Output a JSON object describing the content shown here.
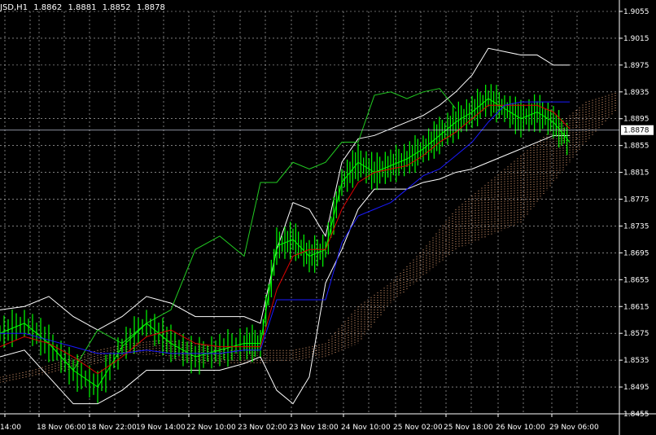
{
  "header": {
    "symbol": "JSD,H1",
    "open": "1.8862",
    "high": "1.8881",
    "low": "1.8852",
    "close": "1.8878"
  },
  "colors": {
    "background": "#000000",
    "grid": "#c8c8c8",
    "axis": "#ffffff",
    "candles": "#00ff00",
    "bollinger": "#ffffff",
    "chikou": "#22cc22",
    "tenkan": "#dd0000",
    "kijun": "#1a1aff",
    "kumo": "#f0a878",
    "current_price_line": "#b8c0d0"
  },
  "chart_data": {
    "type": "line",
    "y_ticks": [
      "1.9055",
      "1.9015",
      "1.8975",
      "1.8935",
      "1.8895",
      "1.8855",
      "1.8815",
      "1.8775",
      "1.8735",
      "1.8695",
      "1.8655",
      "1.8615",
      "1.8575",
      "1.8535",
      "1.8495",
      "1.8455"
    ],
    "ylim": [
      1.8455,
      1.9055
    ],
    "current_price": "1.8878",
    "x_labels": [
      "14:00",
      "18 Nov 06:00",
      "18 Nov 22:00",
      "19 Nov 14:00",
      "22 Nov 10:00",
      "23 Nov 02:00",
      "23 Nov 18:00",
      "24 Nov 10:00",
      "25 Nov 02:00",
      "25 Nov 18:00",
      "26 Nov 10:00",
      "29 Nov 06:00"
    ],
    "grid": true,
    "series": [
      {
        "key": "close",
        "x": [
          0,
          30,
          60,
          90,
          120,
          150,
          180,
          210,
          240,
          270,
          300,
          320,
          340,
          360,
          380,
          400,
          420,
          440,
          460,
          480,
          500,
          520,
          540,
          560,
          580,
          600,
          620,
          640,
          660,
          680,
          700
        ],
        "values": [
          1.8575,
          1.859,
          1.856,
          1.852,
          1.8495,
          1.8555,
          1.859,
          1.856,
          1.854,
          1.855,
          1.856,
          1.856,
          1.8705,
          1.8715,
          1.869,
          1.87,
          1.88,
          1.883,
          1.8815,
          1.8825,
          1.8835,
          1.885,
          1.887,
          1.889,
          1.8905,
          1.8925,
          1.891,
          1.8895,
          1.8905,
          1.889,
          1.886
        ]
      },
      {
        "key": "bb_upper",
        "x": [
          0,
          30,
          60,
          90,
          120,
          150,
          180,
          210,
          240,
          270,
          300,
          320,
          340,
          360,
          380,
          400,
          420,
          440,
          460,
          480,
          500,
          520,
          540,
          560,
          580,
          600,
          620,
          640,
          660,
          680,
          700
        ],
        "values": [
          1.861,
          1.8615,
          1.863,
          1.86,
          1.858,
          1.86,
          1.863,
          1.862,
          1.86,
          1.86,
          1.86,
          1.859,
          1.87,
          1.877,
          1.876,
          1.872,
          1.883,
          1.8865,
          1.887,
          1.888,
          1.889,
          1.89,
          1.8915,
          1.8935,
          1.896,
          1.9,
          1.8995,
          1.899,
          1.899,
          1.8975,
          1.8975
        ]
      },
      {
        "key": "bb_lower",
        "x": [
          0,
          30,
          60,
          90,
          120,
          150,
          180,
          210,
          240,
          270,
          300,
          320,
          340,
          360,
          380,
          400,
          420,
          440,
          460,
          480,
          500,
          520,
          540,
          560,
          580,
          600,
          620,
          640,
          660,
          680,
          700
        ],
        "values": [
          1.854,
          1.855,
          1.851,
          1.847,
          1.847,
          1.849,
          1.852,
          1.852,
          1.852,
          1.852,
          1.853,
          1.854,
          1.849,
          1.847,
          1.851,
          1.865,
          1.87,
          1.876,
          1.879,
          1.879,
          1.879,
          1.88,
          1.8805,
          1.8815,
          1.882,
          1.883,
          1.884,
          1.885,
          1.886,
          1.887,
          1.887
        ]
      },
      {
        "key": "chikou",
        "x": [
          0,
          30,
          60,
          90,
          120,
          150,
          180,
          210,
          240,
          270,
          300,
          320,
          340,
          360,
          380,
          400,
          420,
          440,
          460,
          480,
          500,
          520,
          540,
          560
        ],
        "values": [
          1.8575,
          1.859,
          1.856,
          1.852,
          1.858,
          1.856,
          1.859,
          1.861,
          1.87,
          1.872,
          1.869,
          1.88,
          1.88,
          1.883,
          1.882,
          1.883,
          1.886,
          1.886,
          1.893,
          1.8935,
          1.8925,
          1.8935,
          1.894,
          1.891
        ]
      },
      {
        "key": "tenkan",
        "x": [
          0,
          30,
          60,
          90,
          120,
          150,
          180,
          210,
          240,
          270,
          300,
          320,
          340,
          360,
          380,
          400,
          420,
          440,
          460,
          480,
          500,
          520,
          540,
          560,
          580,
          600,
          620,
          640,
          660,
          680,
          700
        ],
        "values": [
          1.8555,
          1.857,
          1.856,
          1.854,
          1.8515,
          1.854,
          1.857,
          1.858,
          1.856,
          1.8555,
          1.8555,
          1.8555,
          1.864,
          1.869,
          1.87,
          1.87,
          1.876,
          1.88,
          1.8815,
          1.882,
          1.8825,
          1.884,
          1.886,
          1.8875,
          1.8895,
          1.8915,
          1.8915,
          1.8915,
          1.8915,
          1.8905,
          1.888
        ]
      },
      {
        "key": "kijun",
        "x": [
          0,
          30,
          60,
          90,
          120,
          150,
          180,
          210,
          240,
          270,
          300,
          320,
          340,
          360,
          380,
          400,
          420,
          440,
          460,
          480,
          500,
          520,
          540,
          560,
          580,
          600,
          620,
          640,
          660,
          680,
          700
        ],
        "values": [
          1.8575,
          1.8575,
          1.8565,
          1.8555,
          1.8545,
          1.8545,
          1.855,
          1.8545,
          1.8545,
          1.8545,
          1.855,
          1.855,
          1.8625,
          1.8625,
          1.8625,
          1.8625,
          1.871,
          1.875,
          1.876,
          1.877,
          1.879,
          1.881,
          1.882,
          1.884,
          1.886,
          1.889,
          1.8915,
          1.892,
          1.892,
          1.892,
          1.892
        ]
      },
      {
        "key": "senkou_a",
        "x": [
          0,
          40,
          80,
          120,
          160,
          200,
          240,
          280,
          320,
          360,
          400,
          440,
          480,
          520,
          560,
          600,
          640,
          680,
          720,
          760
        ],
        "values": [
          1.851,
          1.852,
          1.8535,
          1.855,
          1.856,
          1.8565,
          1.856,
          1.855,
          1.855,
          1.855,
          1.856,
          1.8615,
          1.865,
          1.87,
          1.876,
          1.88,
          1.884,
          1.888,
          1.892,
          1.8935
        ]
      },
      {
        "key": "senkou_b",
        "x": [
          0,
          40,
          80,
          120,
          160,
          200,
          240,
          280,
          320,
          360,
          400,
          440,
          480,
          520,
          560,
          600,
          640,
          680,
          720,
          760
        ],
        "values": [
          1.85,
          1.851,
          1.852,
          1.853,
          1.8545,
          1.854,
          1.853,
          1.853,
          1.853,
          1.8535,
          1.854,
          1.856,
          1.862,
          1.866,
          1.87,
          1.872,
          1.874,
          1.88,
          1.886,
          1.891
        ]
      }
    ]
  }
}
